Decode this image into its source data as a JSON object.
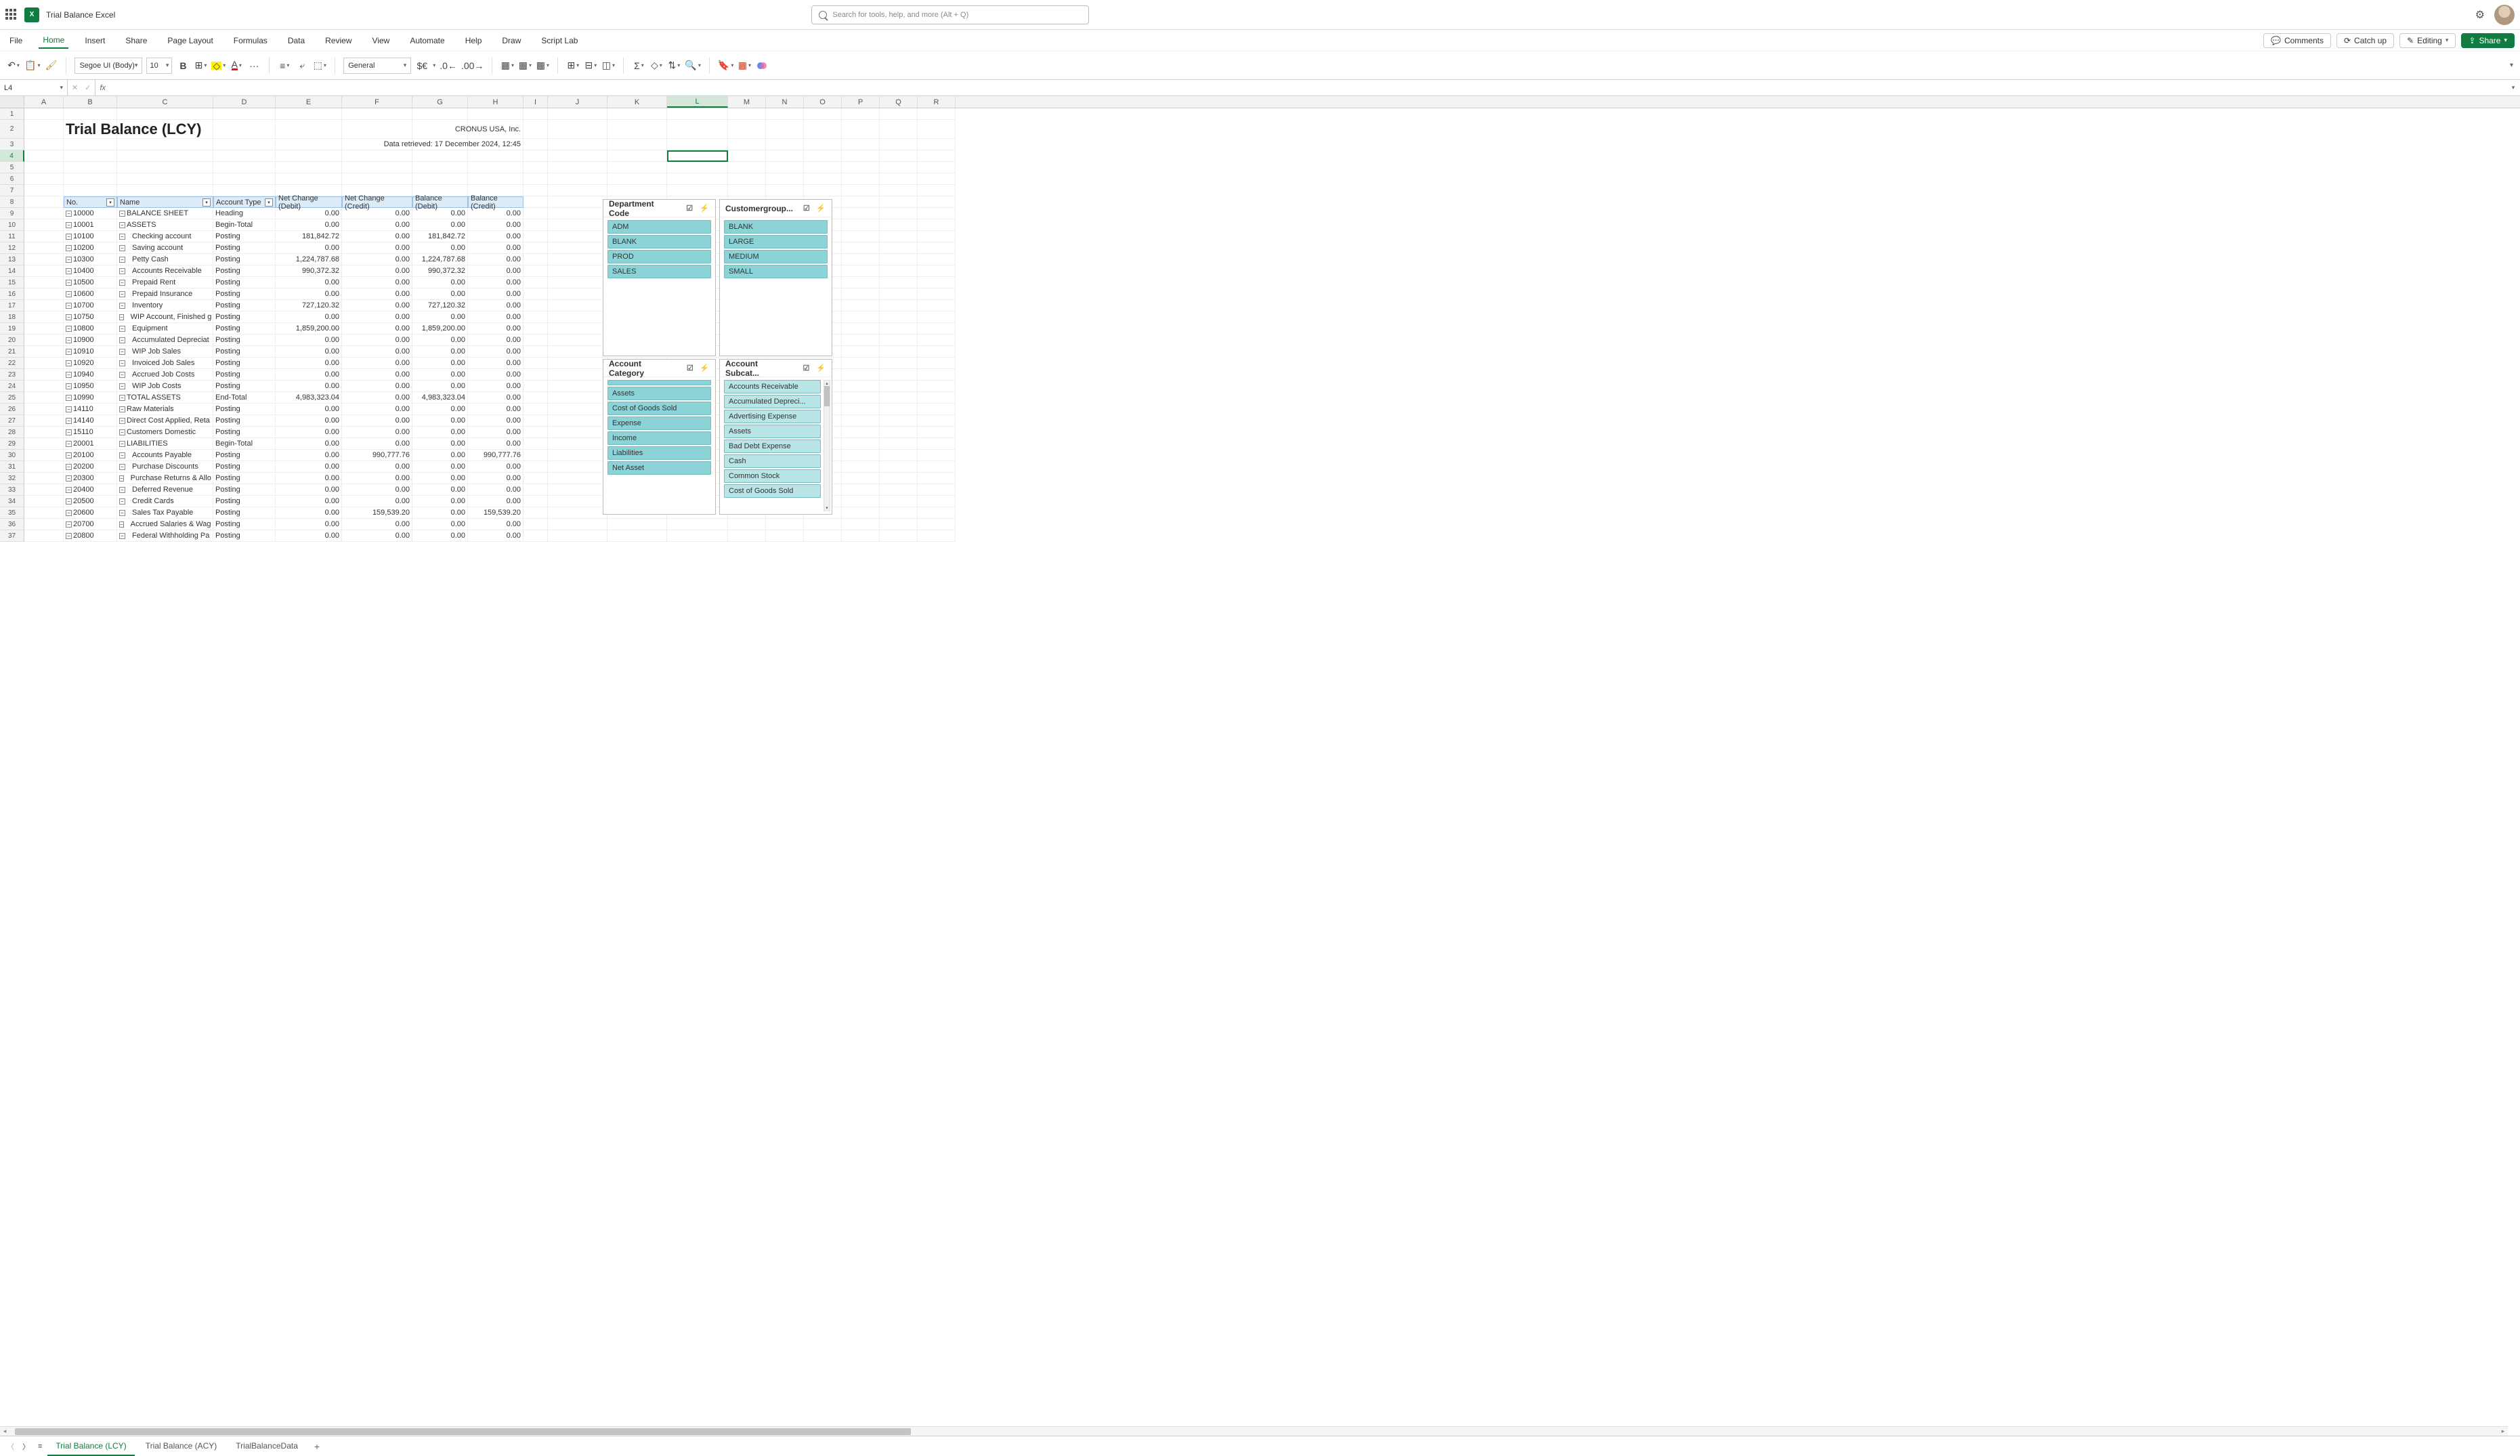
{
  "app": {
    "name": "X",
    "doc_title": "Trial Balance Excel"
  },
  "search": {
    "placeholder": "Search for tools, help, and more (Alt + Q)"
  },
  "tabs": {
    "file": "File",
    "home": "Home",
    "insert": "Insert",
    "share_tab": "Share",
    "page_layout": "Page Layout",
    "formulas": "Formulas",
    "data": "Data",
    "review": "Review",
    "view": "View",
    "automate": "Automate",
    "help": "Help",
    "draw": "Draw",
    "script_lab": "Script Lab"
  },
  "ribbon_right": {
    "comments": "Comments",
    "catch_up": "Catch up",
    "editing": "Editing",
    "share": "Share"
  },
  "ribbon": {
    "font_name": "Segoe UI (Body)",
    "font_size": "10",
    "number_format": "General",
    "bold": "B",
    "font_color": "A",
    "fill": "◆",
    "more": "···",
    "currency": "$€"
  },
  "namebox": {
    "value": "L4"
  },
  "fbar": {
    "cancel": "✕",
    "accept": "✓",
    "fx": "fx"
  },
  "columns": [
    "A",
    "B",
    "C",
    "D",
    "E",
    "F",
    "G",
    "H",
    "I",
    "J",
    "K",
    "L",
    "M",
    "N",
    "O",
    "P",
    "Q",
    "R"
  ],
  "report": {
    "title": "Trial Balance (LCY)",
    "company": "CRONUS USA, Inc.",
    "retrieved": "Data retrieved: 17 December 2024, 12:45"
  },
  "headers": {
    "no": "No.",
    "name": "Name",
    "acct_type": "Account Type",
    "ncd": "Net Change (Debit)",
    "ncc": "Net Change (Credit)",
    "bd": "Balance (Debit)",
    "bc": "Balance (Credit)"
  },
  "rows": [
    {
      "no": "10000",
      "name": "BALANCE SHEET",
      "type": "Heading",
      "ncd": "0.00",
      "ncc": "0.00",
      "bd": "0.00",
      "bc": "0.00",
      "indent": 0
    },
    {
      "no": "10001",
      "name": "ASSETS",
      "type": "Begin-Total",
      "ncd": "0.00",
      "ncc": "0.00",
      "bd": "0.00",
      "bc": "0.00",
      "indent": 0
    },
    {
      "no": "10100",
      "name": "Checking account",
      "type": "Posting",
      "ncd": "181,842.72",
      "ncc": "0.00",
      "bd": "181,842.72",
      "bc": "0.00",
      "indent": 1
    },
    {
      "no": "10200",
      "name": "Saving account",
      "type": "Posting",
      "ncd": "0.00",
      "ncc": "0.00",
      "bd": "0.00",
      "bc": "0.00",
      "indent": 1
    },
    {
      "no": "10300",
      "name": "Petty Cash",
      "type": "Posting",
      "ncd": "1,224,787.68",
      "ncc": "0.00",
      "bd": "1,224,787.68",
      "bc": "0.00",
      "indent": 1
    },
    {
      "no": "10400",
      "name": "Accounts Receivable",
      "type": "Posting",
      "ncd": "990,372.32",
      "ncc": "0.00",
      "bd": "990,372.32",
      "bc": "0.00",
      "indent": 1
    },
    {
      "no": "10500",
      "name": "Prepaid Rent",
      "type": "Posting",
      "ncd": "0.00",
      "ncc": "0.00",
      "bd": "0.00",
      "bc": "0.00",
      "indent": 1
    },
    {
      "no": "10600",
      "name": "Prepaid Insurance",
      "type": "Posting",
      "ncd": "0.00",
      "ncc": "0.00",
      "bd": "0.00",
      "bc": "0.00",
      "indent": 1
    },
    {
      "no": "10700",
      "name": "Inventory",
      "type": "Posting",
      "ncd": "727,120.32",
      "ncc": "0.00",
      "bd": "727,120.32",
      "bc": "0.00",
      "indent": 1
    },
    {
      "no": "10750",
      "name": "WIP Account, Finished g",
      "type": "Posting",
      "ncd": "0.00",
      "ncc": "0.00",
      "bd": "0.00",
      "bc": "0.00",
      "indent": 1
    },
    {
      "no": "10800",
      "name": "Equipment",
      "type": "Posting",
      "ncd": "1,859,200.00",
      "ncc": "0.00",
      "bd": "1,859,200.00",
      "bc": "0.00",
      "indent": 1
    },
    {
      "no": "10900",
      "name": "Accumulated Depreciat",
      "type": "Posting",
      "ncd": "0.00",
      "ncc": "0.00",
      "bd": "0.00",
      "bc": "0.00",
      "indent": 1
    },
    {
      "no": "10910",
      "name": "WIP Job Sales",
      "type": "Posting",
      "ncd": "0.00",
      "ncc": "0.00",
      "bd": "0.00",
      "bc": "0.00",
      "indent": 1
    },
    {
      "no": "10920",
      "name": "Invoiced Job Sales",
      "type": "Posting",
      "ncd": "0.00",
      "ncc": "0.00",
      "bd": "0.00",
      "bc": "0.00",
      "indent": 1
    },
    {
      "no": "10940",
      "name": "Accrued Job Costs",
      "type": "Posting",
      "ncd": "0.00",
      "ncc": "0.00",
      "bd": "0.00",
      "bc": "0.00",
      "indent": 1
    },
    {
      "no": "10950",
      "name": "WIP Job Costs",
      "type": "Posting",
      "ncd": "0.00",
      "ncc": "0.00",
      "bd": "0.00",
      "bc": "0.00",
      "indent": 1
    },
    {
      "no": "10990",
      "name": "TOTAL ASSETS",
      "type": "End-Total",
      "ncd": "4,983,323.04",
      "ncc": "0.00",
      "bd": "4,983,323.04",
      "bc": "0.00",
      "indent": 0
    },
    {
      "no": "14110",
      "name": "Raw Materials",
      "type": "Posting",
      "ncd": "0.00",
      "ncc": "0.00",
      "bd": "0.00",
      "bc": "0.00",
      "indent": 0
    },
    {
      "no": "14140",
      "name": "Direct Cost Applied, Reta",
      "type": "Posting",
      "ncd": "0.00",
      "ncc": "0.00",
      "bd": "0.00",
      "bc": "0.00",
      "indent": 0
    },
    {
      "no": "15110",
      "name": "Customers Domestic",
      "type": "Posting",
      "ncd": "0.00",
      "ncc": "0.00",
      "bd": "0.00",
      "bc": "0.00",
      "indent": 0
    },
    {
      "no": "20001",
      "name": "LIABILITIES",
      "type": "Begin-Total",
      "ncd": "0.00",
      "ncc": "0.00",
      "bd": "0.00",
      "bc": "0.00",
      "indent": 0
    },
    {
      "no": "20100",
      "name": "Accounts Payable",
      "type": "Posting",
      "ncd": "0.00",
      "ncc": "990,777.76",
      "bd": "0.00",
      "bc": "990,777.76",
      "indent": 1
    },
    {
      "no": "20200",
      "name": "Purchase Discounts",
      "type": "Posting",
      "ncd": "0.00",
      "ncc": "0.00",
      "bd": "0.00",
      "bc": "0.00",
      "indent": 1
    },
    {
      "no": "20300",
      "name": "Purchase Returns & Allo",
      "type": "Posting",
      "ncd": "0.00",
      "ncc": "0.00",
      "bd": "0.00",
      "bc": "0.00",
      "indent": 1
    },
    {
      "no": "20400",
      "name": "Deferred Revenue",
      "type": "Posting",
      "ncd": "0.00",
      "ncc": "0.00",
      "bd": "0.00",
      "bc": "0.00",
      "indent": 1
    },
    {
      "no": "20500",
      "name": "Credit Cards",
      "type": "Posting",
      "ncd": "0.00",
      "ncc": "0.00",
      "bd": "0.00",
      "bc": "0.00",
      "indent": 1
    },
    {
      "no": "20600",
      "name": "Sales Tax Payable",
      "type": "Posting",
      "ncd": "0.00",
      "ncc": "159,539.20",
      "bd": "0.00",
      "bc": "159,539.20",
      "indent": 1
    },
    {
      "no": "20700",
      "name": "Accrued Salaries & Wag",
      "type": "Posting",
      "ncd": "0.00",
      "ncc": "0.00",
      "bd": "0.00",
      "bc": "0.00",
      "indent": 1
    },
    {
      "no": "20800",
      "name": "Federal Withholding Pa",
      "type": "Posting",
      "ncd": "0.00",
      "ncc": "0.00",
      "bd": "0.00",
      "bc": "0.00",
      "indent": 1
    }
  ],
  "slicers": {
    "dept": {
      "title": "Department Code",
      "items": [
        "ADM",
        "BLANK",
        "PROD",
        "SALES"
      ]
    },
    "cust": {
      "title": "Customergroup...",
      "items": [
        "BLANK",
        "LARGE",
        "MEDIUM",
        "SMALL"
      ]
    },
    "cat": {
      "title": "Account Category",
      "items": [
        "",
        "Assets",
        "Cost of Goods Sold",
        "Expense",
        "Income",
        "Liabilities",
        "Net Asset"
      ]
    },
    "sub": {
      "title": "Account Subcat...",
      "items": [
        "Accounts Receivable",
        "Accumulated Depreci...",
        "Advertising Expense",
        "Assets",
        "Bad Debt Expense",
        "Cash",
        "Common Stock",
        "Cost of Goods Sold"
      ]
    }
  },
  "sheets": {
    "s1": "Trial Balance (LCY)",
    "s2": "Trial Balance (ACY)",
    "s3": "TrialBalanceData"
  },
  "glyphs": {
    "expand": "⊟",
    "minus": "−",
    "list": "≡",
    "filter": "▽",
    "dd": "▾",
    "dd2": "▼"
  }
}
